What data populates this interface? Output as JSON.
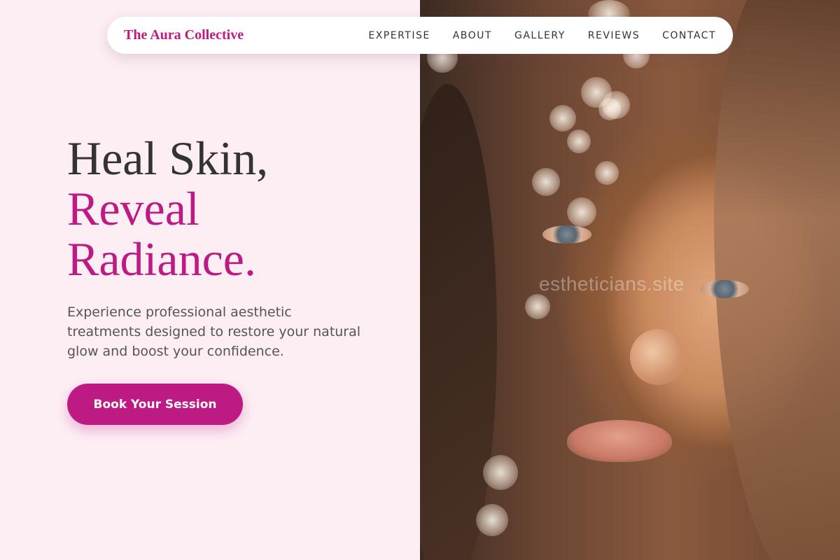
{
  "nav": {
    "brand": "The Aura Collective",
    "links": [
      "EXPERTISE",
      "ABOUT",
      "GALLERY",
      "REVIEWS",
      "CONTACT"
    ]
  },
  "hero": {
    "title_line1": "Heal Skin,",
    "title_line2": "Reveal",
    "title_line3": "Radiance.",
    "subtitle": "Experience professional aesthetic treatments designed to restore your natural glow and boost your confidence.",
    "cta_label": "Book Your Session"
  },
  "image": {
    "watermark": "estheticians.site"
  },
  "colors": {
    "brand": "#be1a84",
    "background": "#fdeef4",
    "text_dark": "#333333",
    "text_muted": "#555555"
  }
}
